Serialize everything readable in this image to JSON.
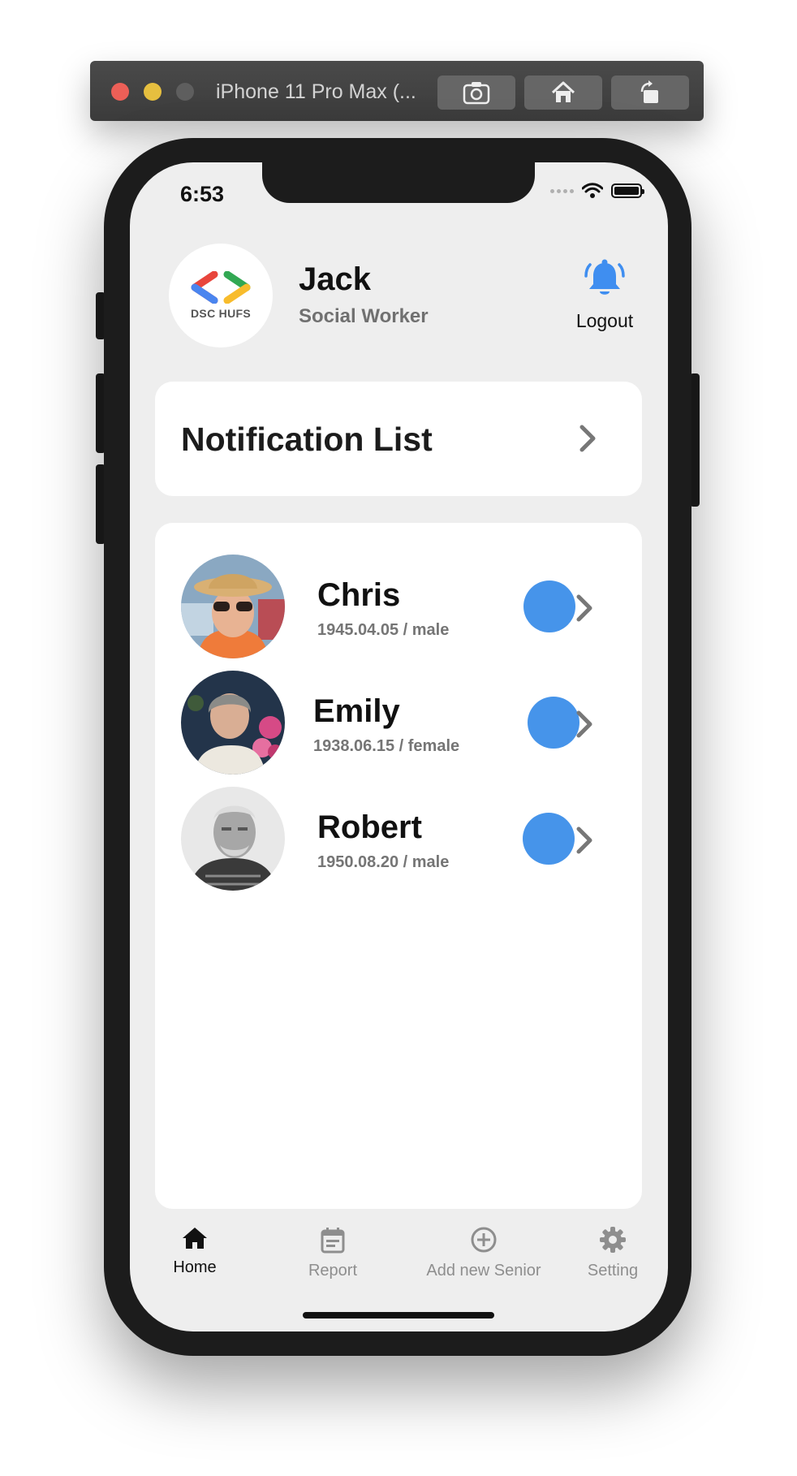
{
  "simulator": {
    "title": "iPhone 11 Pro Max (...",
    "buttons": [
      "screenshot-icon",
      "home-icon",
      "rotate-icon"
    ]
  },
  "status_bar": {
    "time": "6:53"
  },
  "header": {
    "logo_text": "DSC HUFS",
    "user_name": "Jack",
    "user_role": "Social Worker",
    "logout_label": "Logout"
  },
  "notification": {
    "title": "Notification List"
  },
  "seniors": [
    {
      "name": "Chris",
      "info": "1945.04.05 / male"
    },
    {
      "name": "Emily",
      "info": "1938.06.15 / female"
    },
    {
      "name": "Robert",
      "info": "1950.08.20 / male"
    }
  ],
  "tabs": [
    {
      "label": "Home",
      "icon": "home-icon",
      "active": true
    },
    {
      "label": "Report",
      "icon": "calendar-icon",
      "active": false
    },
    {
      "label": "Add new Senior",
      "icon": "add-circle-icon",
      "active": false
    },
    {
      "label": "Setting",
      "icon": "gear-icon",
      "active": false
    }
  ],
  "colors": {
    "accent_blue": "#4694ea",
    "background": "#eeeeee",
    "card": "#ffffff"
  }
}
